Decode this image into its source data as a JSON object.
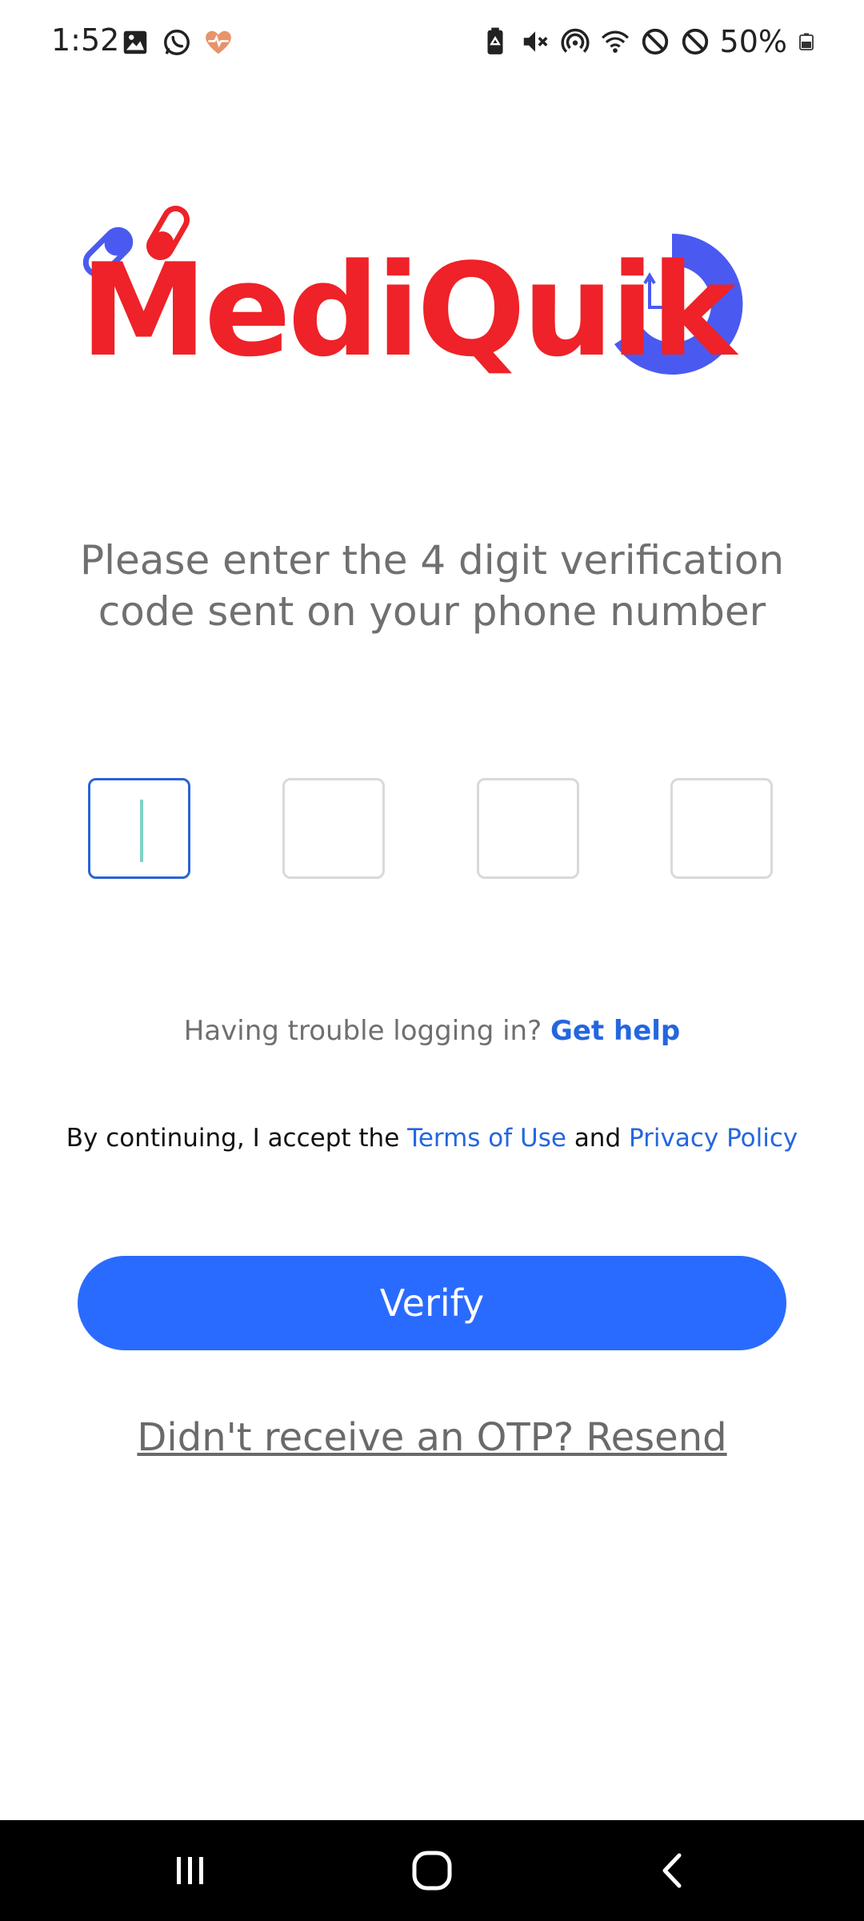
{
  "status_bar": {
    "time": "1:52",
    "battery_percent": "50%",
    "left_icons": [
      "gallery-icon",
      "whatsapp-icon",
      "heart-rate-icon"
    ],
    "right_icons": [
      "battery-saver-icon",
      "mute-icon",
      "hotspot-icon",
      "wifi-icon",
      "block-icon",
      "block-icon",
      "battery-icon"
    ]
  },
  "brand": {
    "name": "MediQuik",
    "colors": {
      "red": "#ee2228",
      "blue": "#4a5af0"
    }
  },
  "verification": {
    "instruction": "Please enter the 4 digit verification code sent on your phone number",
    "otp_digits": [
      "",
      "",
      "",
      ""
    ],
    "active_index": 0
  },
  "help": {
    "prompt": "Having trouble logging in?",
    "link_label": "Get help"
  },
  "terms": {
    "prefix": "By continuing, I accept the",
    "terms_label": "Terms of Use",
    "conjunction": "and",
    "privacy_label": "Privacy Policy"
  },
  "actions": {
    "verify_label": "Verify",
    "resend_label": "Didn't receive an OTP? Resend"
  },
  "colors": {
    "accent": "#2a6bff",
    "link": "#2466e0"
  },
  "nav_bar": {
    "buttons": [
      "recent-apps-icon",
      "home-icon",
      "back-icon"
    ]
  }
}
